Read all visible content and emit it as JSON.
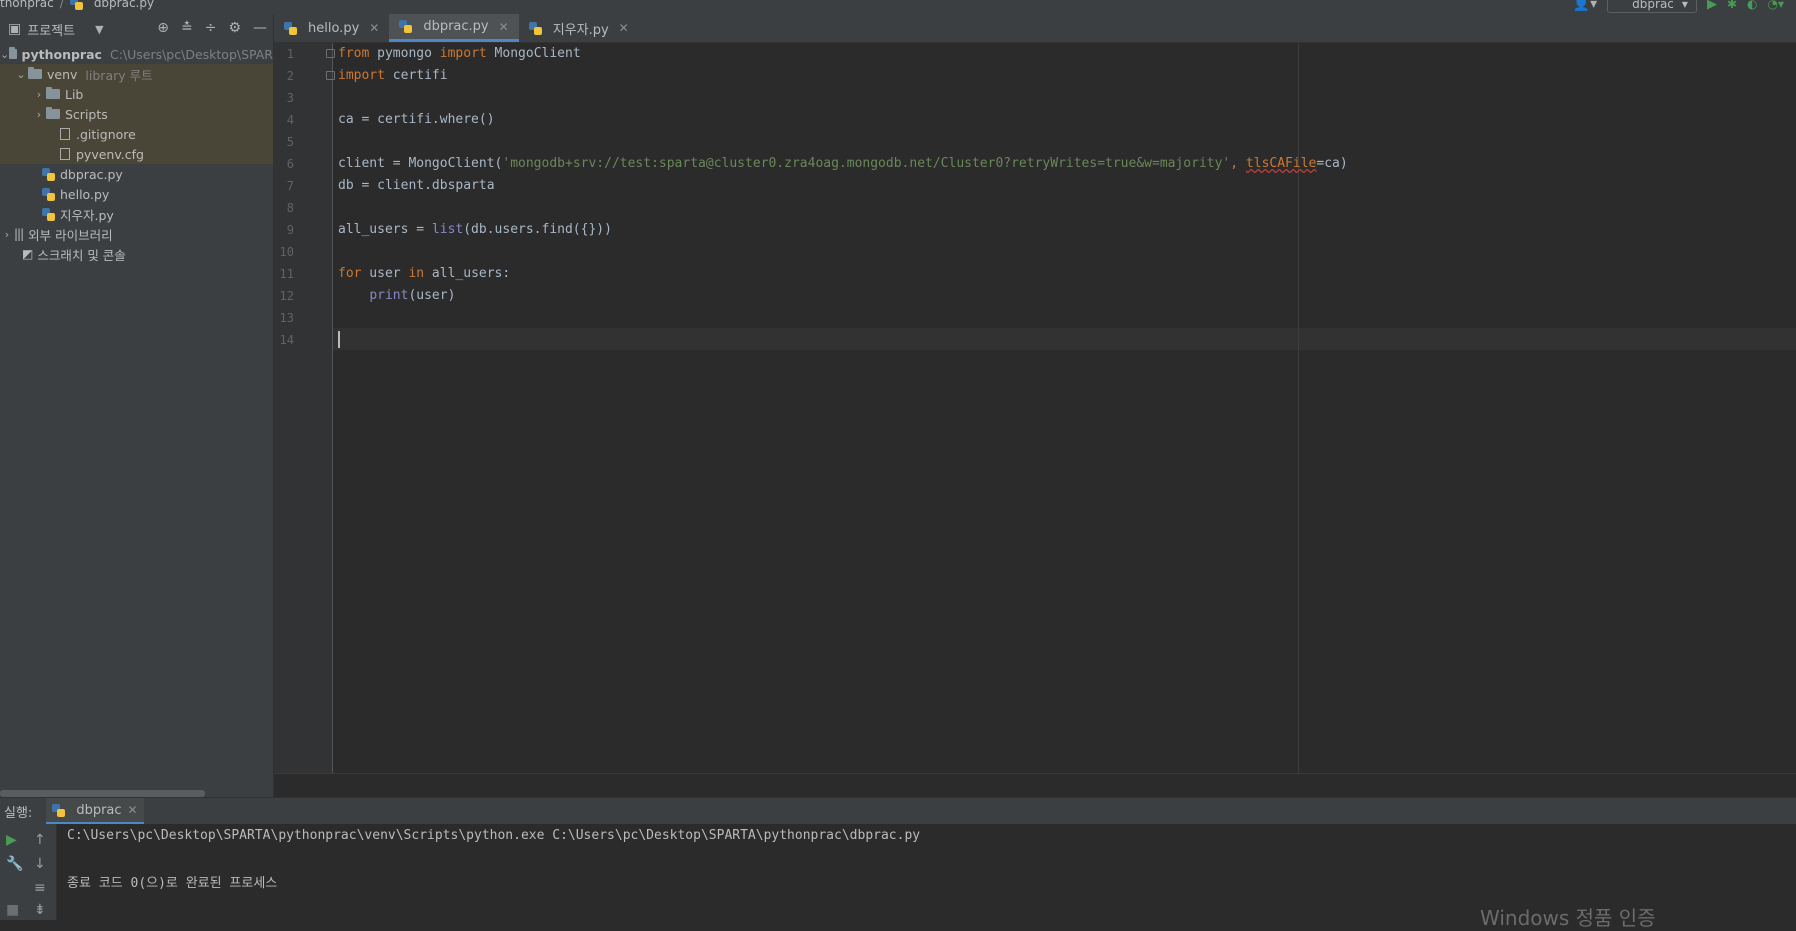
{
  "breadcrumb": {
    "project": "thonprac",
    "file": "dbprac.py"
  },
  "toolbar": {
    "run_config": "dbprac"
  },
  "project_panel": {
    "title": "프로젝트",
    "root": {
      "name": "pythonprac",
      "path": "C:\\Users\\pc\\Desktop\\SPAR"
    },
    "venv": {
      "name": "venv",
      "hint": "library 루트"
    },
    "items": [
      {
        "label": "Lib"
      },
      {
        "label": "Scripts"
      },
      {
        "label": ".gitignore"
      },
      {
        "label": "pyvenv.cfg"
      },
      {
        "label": "dbprac.py"
      },
      {
        "label": "hello.py"
      },
      {
        "label": "지우자.py"
      },
      {
        "label": "외부 라이브러리"
      },
      {
        "label": "스크래치 및 콘솔"
      }
    ]
  },
  "tabs": [
    {
      "label": "hello.py",
      "active": false
    },
    {
      "label": "dbprac.py",
      "active": true
    },
    {
      "label": "지우자.py",
      "active": false
    }
  ],
  "editor": {
    "line_numbers": [
      "1",
      "2",
      "3",
      "4",
      "5",
      "6",
      "7",
      "8",
      "9",
      "10",
      "11",
      "12",
      "13",
      "14"
    ],
    "code": {
      "l1_kw1": "from",
      "l1_mod": " pymongo ",
      "l1_kw2": "import",
      "l1_name": " MongoClient",
      "l2_kw": "import",
      "l2_mod": " certifi",
      "l4": "ca = certifi.where()",
      "l6_a": "client = MongoClient(",
      "l6_str": "'mongodb+srv://test:sparta@cluster0.zra4oag.mongodb.net/Cluster0?retryWrites=true&w=majority'",
      "l6_b": ", ",
      "l6_kwarg": "tlsCAFile",
      "l6_c": "=ca)",
      "l7": "db = client.dbsparta",
      "l9_a": "all_users = ",
      "l9_bi": "list",
      "l9_b": "(db.users.find({}))",
      "l11_kw1": "for",
      "l11_a": " user ",
      "l11_kw2": "in",
      "l11_b": " all_users:",
      "l12_indent": "    ",
      "l12_bi": "print",
      "l12_a": "(user)"
    }
  },
  "run_panel": {
    "label": "실행:",
    "tab": "dbprac",
    "output": [
      "C:\\Users\\pc\\Desktop\\SPARTA\\pythonprac\\venv\\Scripts\\python.exe C:\\Users\\pc\\Desktop\\SPARTA\\pythonprac\\dbprac.py",
      "",
      "종료 코드 0(으)로 완료된 프로세스"
    ]
  },
  "watermark": "Windows 정품 인증"
}
